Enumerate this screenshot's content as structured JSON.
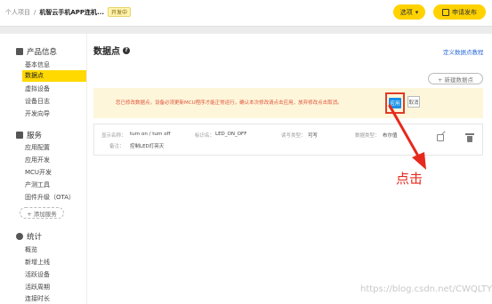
{
  "breadcrumb": {
    "root": "个人项目",
    "separator": "/",
    "project": "机智云手机APP连机...",
    "status_badge": "开发中"
  },
  "header": {
    "options_label": "选项",
    "options_chevron": "▾",
    "publish_label": "申请发布"
  },
  "sidebar": {
    "sections": [
      {
        "title": "产品信息",
        "icon": "grid-icon",
        "items": [
          "基本信息",
          "数据点",
          "虚拟设备",
          "设备日志",
          "开发向导"
        ]
      },
      {
        "title": "服务",
        "icon": "grid-icon",
        "items": [
          "应用配置",
          "应用开发",
          "MCU开发",
          "产测工具",
          "固件升级（OTA）"
        ]
      },
      {
        "title": "统计",
        "icon": "pie-chart-icon",
        "items": [
          "概览",
          "新增上线",
          "活跃设备",
          "活跃周期",
          "连接时长"
        ]
      }
    ],
    "active_item": "数据点",
    "add_service_label": "+ 添加服务"
  },
  "main": {
    "title": "数据点",
    "help_icon": "?",
    "tutorial_link": "定义数据点教程",
    "new_datapoint_label": "+ 新建数据点",
    "notice": {
      "message": "您已修改数据点，设备必须更新MCU程序才能正常运行，确认本次修改请点击应用，放弃修改点击取消。",
      "apply_label": "应用",
      "cancel_label": "取消"
    },
    "datapoint": {
      "display_name_label": "显示名称：",
      "display_name": "turn on / turn off",
      "identifier_label": "标识名：",
      "identifier": "LED_ON_OFF",
      "rw_type_label": "读写类型：",
      "rw_type": "可写",
      "data_type_label": "数据类型：",
      "data_type": "布尔值",
      "remark_label": "备注：",
      "remark": "控制LED灯亮灭"
    }
  },
  "annotation": {
    "text": "点击",
    "color": "#e6291c"
  },
  "watermark": "https://blog.csdn.net/CWQLTYH",
  "colors": {
    "accent": "#ffd200",
    "primary_button": "#1790e8",
    "highlight_border": "#e23b2a",
    "notice_bg": "#fdf6da",
    "link": "#2a6bd6"
  }
}
